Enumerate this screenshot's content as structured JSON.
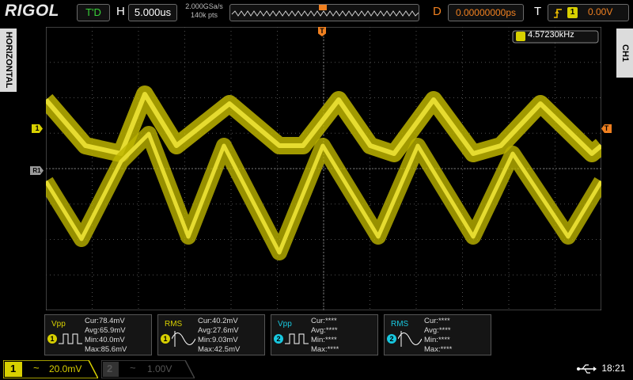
{
  "top": {
    "brand": "RIGOL",
    "trigger_status": "T'D",
    "horizontal_label": "H",
    "timebase": "5.000us",
    "sample_rate": "2.000GSa/s",
    "memory_depth": "140k pts",
    "delay_label": "D",
    "delay_value": "0.00000000ps",
    "trigger_label": "T",
    "trigger_level": "0.00V",
    "trigger_source": "1"
  },
  "side": {
    "left_tab": "HORIZONTAL",
    "right_tab": "CH1"
  },
  "screen": {
    "trigger_marker": "T",
    "ch1_marker": "1",
    "ref_marker": "R1",
    "trigger_level_marker": "T",
    "frequency": "4.57230kHz"
  },
  "measurements": [
    {
      "name": "Vpp",
      "channel": "1",
      "cur": "Cur:78.4mV",
      "avg": "Avg:65.9mV",
      "min": "Min:40.0mV",
      "max": "Max:85.6mV"
    },
    {
      "name": "RMS",
      "channel": "1",
      "cur": "Cur:40.2mV",
      "avg": "Avg:27.6mV",
      "min": "Min:9.03mV",
      "max": "Max:42.5mV"
    },
    {
      "name": "Vpp",
      "channel": "2",
      "cur": "Cur:****",
      "avg": "Avg:****",
      "min": "Min:****",
      "max": "Max:****"
    },
    {
      "name": "RMS",
      "channel": "2",
      "cur": "Cur:****",
      "avg": "Avg:****",
      "min": "Min:****",
      "max": "Max:****"
    }
  ],
  "bottom": {
    "ch1_label": "1",
    "ch1_coupling": "~",
    "ch1_scale": "20.0mV",
    "ch2_label": "2",
    "ch2_coupling": "~",
    "ch2_scale": "1.00V",
    "usb_icon": "usb-icon",
    "time": "18:21"
  },
  "colors": {
    "ch1": "#d8d000",
    "ch2": "#18c8e0",
    "trigger": "#f08020",
    "grid": "#505050"
  }
}
